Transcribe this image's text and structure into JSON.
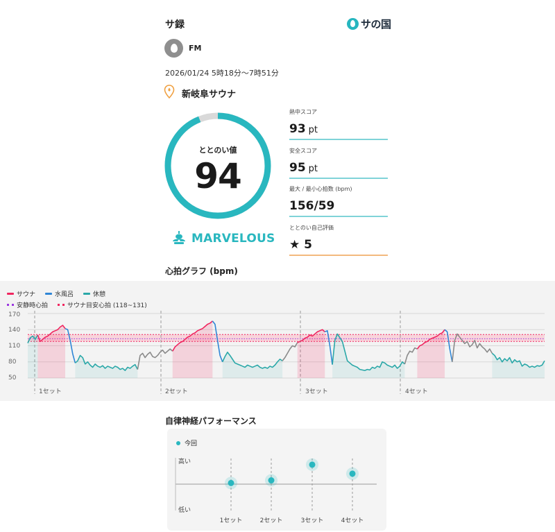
{
  "header": {
    "title": "サ録",
    "brand": "サの国"
  },
  "user": {
    "name": "FM"
  },
  "session": {
    "datetime": "2026/01/24 5時18分〜7時51分"
  },
  "facility": {
    "name": "新岐阜サウナ"
  },
  "totonoi": {
    "label": "ととのい値",
    "value": "94",
    "progress": 0.94,
    "rank": "MARVELOUS"
  },
  "stats": [
    {
      "label": "熱中スコア",
      "value": "93",
      "unit": "pt"
    },
    {
      "label": "安全スコア",
      "value": "95",
      "unit": "pt"
    },
    {
      "label": "最大 / 最小心拍数 (bpm)",
      "value": "156/59",
      "unit": ""
    },
    {
      "label": "ととのい自己評価",
      "value": "★ 5",
      "unit": ""
    }
  ],
  "graph": {
    "title": "心拍グラフ (bpm)",
    "legend": {
      "sauna": "サウナ",
      "cold": "水風呂",
      "rest": "休憩",
      "resting_hr": "安静時心拍",
      "target": "サウナ目安心拍 (118~131)"
    },
    "y_ticks": [
      "170",
      "140",
      "110",
      "80",
      "50"
    ],
    "sets": [
      "1セット",
      "2セット",
      "3セット",
      "4セット"
    ],
    "colors": {
      "sauna": "#f0255f",
      "cold": "#2f86d6",
      "rest": "#2aa8a8",
      "idle": "#8a8a8a",
      "resting": "#9b38e0"
    }
  },
  "performance": {
    "title": "自律神経パフォーマンス",
    "legend": "今回",
    "y_high": "高い",
    "y_low": "低い",
    "sets": [
      "1セット",
      "2セット",
      "3セット",
      "4セット"
    ],
    "levels": [
      0.2,
      0.28,
      0.75,
      0.48
    ]
  },
  "chart_data": {
    "type": "line",
    "title": "心拍グラフ (bpm)",
    "ylim": [
      50,
      170
    ],
    "y_ticks": [
      170,
      140,
      110,
      80,
      50
    ],
    "target_band": [
      118,
      131
    ],
    "resting_hr": 123,
    "phases": [
      {
        "phase": "rest",
        "values": [
          115,
          125,
          128,
          122,
          130
        ]
      },
      {
        "phase": "sauna",
        "values": [
          118,
          122,
          126,
          128,
          132,
          136,
          138,
          140,
          145,
          148,
          142
        ]
      },
      {
        "phase": "cold",
        "values": [
          140,
          120,
          95,
          78
        ]
      },
      {
        "phase": "rest",
        "values": [
          82,
          92,
          88,
          76,
          80,
          74,
          70,
          76,
          72,
          70,
          73,
          68,
          72,
          70,
          68,
          72,
          70,
          66,
          68,
          64,
          70,
          68,
          72,
          75,
          66
        ]
      },
      {
        "phase": "idle",
        "values": [
          92,
          96,
          88,
          94,
          98,
          90,
          88,
          92,
          98,
          102,
          96,
          100,
          104,
          100
        ]
      },
      {
        "phase": "sauna",
        "values": [
          108,
          112,
          116,
          118,
          122,
          126,
          128,
          132,
          134,
          138,
          140,
          142,
          146,
          150,
          152,
          156
        ]
      },
      {
        "phase": "cold",
        "values": [
          150,
          120,
          92,
          80
        ]
      },
      {
        "phase": "rest",
        "values": [
          90,
          98,
          92,
          85,
          78,
          76,
          74,
          72,
          70,
          74,
          72,
          70,
          72,
          74,
          70,
          68,
          70,
          68,
          72,
          70,
          74,
          80,
          85,
          82
        ]
      },
      {
        "phase": "idle",
        "values": [
          88,
          96,
          104,
          110,
          108,
          116
        ]
      },
      {
        "phase": "sauna",
        "values": [
          118,
          120,
          124,
          126,
          130,
          128,
          132,
          136,
          138,
          140,
          136
        ]
      },
      {
        "phase": "cold",
        "values": [
          138,
          110,
          75
        ]
      },
      {
        "phase": "rest",
        "values": [
          120,
          132,
          125,
          118,
          100,
          82,
          78,
          74,
          72,
          70,
          66,
          65,
          64,
          66,
          65,
          70,
          68,
          72,
          70,
          80,
          78,
          74,
          72,
          70,
          74,
          68,
          72,
          80,
          76
        ]
      },
      {
        "phase": "idle",
        "values": [
          92,
          100,
          98,
          106,
          104
        ]
      },
      {
        "phase": "sauna",
        "values": [
          110,
          112,
          116,
          118,
          122,
          124,
          126,
          128,
          132,
          134,
          140
        ]
      },
      {
        "phase": "cold",
        "values": [
          136,
          105,
          80
        ]
      },
      {
        "phase": "idle",
        "values": [
          120,
          132,
          126,
          120,
          114,
          118,
          108,
          112,
          120,
          106,
          114,
          108,
          104,
          98,
          104,
          96
        ]
      },
      {
        "phase": "rest",
        "values": [
          92,
          84,
          88,
          80,
          86,
          82,
          88,
          78,
          84,
          80,
          82,
          72,
          76,
          74,
          70,
          72,
          70,
          73,
          72,
          74,
          82
        ]
      }
    ]
  }
}
